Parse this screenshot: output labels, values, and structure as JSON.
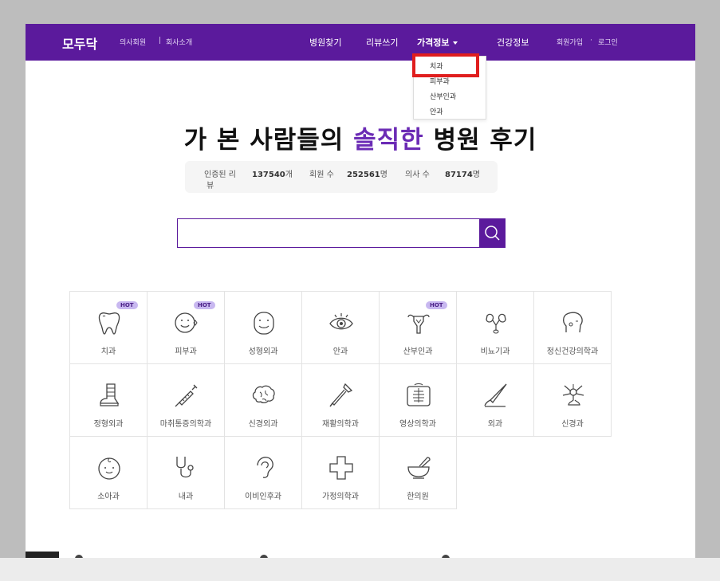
{
  "nav": {
    "logo": "모두닥",
    "doctor_member": "의사회원",
    "separator": "|",
    "company_intro": "회사소개",
    "find_hospital": "병원찾기",
    "write_review": "리뷰쓰기",
    "price_info": "가격정보",
    "health_info": "건강정보",
    "signup": "회원가입",
    "dot": "·",
    "login": "로그인"
  },
  "dropdown": {
    "items": [
      "치과",
      "피부과",
      "산부인과",
      "안과"
    ]
  },
  "hero": {
    "headline_part1": "가 본 사람들의 ",
    "headline_highlight": "솔직한",
    "headline_part2": " 병원 후기"
  },
  "stats": {
    "verified_label": "인증된 리",
    "verified_label_wrap": "뷰",
    "verified_value": "137540",
    "verified_unit": "개",
    "members_label": "회원 수",
    "members_value": "252561",
    "members_unit": "명",
    "doctors_label": "의사 수",
    "doctors_value": "87174",
    "doctors_unit": "명"
  },
  "search": {
    "placeholder": ""
  },
  "departments": [
    {
      "label": "치과",
      "icon": "tooth-icon",
      "hot": "HOT"
    },
    {
      "label": "피부과",
      "icon": "face-sparkle-icon",
      "hot": "HOT"
    },
    {
      "label": "성형외과",
      "icon": "face-icon",
      "hot": ""
    },
    {
      "label": "안과",
      "icon": "eye-icon",
      "hot": ""
    },
    {
      "label": "산부인과",
      "icon": "uterus-icon",
      "hot": "HOT"
    },
    {
      "label": "비뇨기과",
      "icon": "kidney-icon",
      "hot": ""
    },
    {
      "label": "정신건강의학과",
      "icon": "mind-face-icon",
      "hot": ""
    },
    {
      "label": "정형외과",
      "icon": "cast-icon",
      "hot": ""
    },
    {
      "label": "마취통증의학과",
      "icon": "syringe-icon",
      "hot": ""
    },
    {
      "label": "신경외과",
      "icon": "brain-icon",
      "hot": ""
    },
    {
      "label": "재활의학과",
      "icon": "crutch-icon",
      "hot": ""
    },
    {
      "label": "영상의학과",
      "icon": "xray-icon",
      "hot": ""
    },
    {
      "label": "외과",
      "icon": "scalpel-icon",
      "hot": ""
    },
    {
      "label": "신경과",
      "icon": "neuron-icon",
      "hot": ""
    },
    {
      "label": "소아과",
      "icon": "baby-icon",
      "hot": ""
    },
    {
      "label": "내과",
      "icon": "stethoscope-icon",
      "hot": ""
    },
    {
      "label": "이비인후과",
      "icon": "ear-icon",
      "hot": ""
    },
    {
      "label": "가정의학과",
      "icon": "medical-cross-icon",
      "hot": ""
    },
    {
      "label": "한의원",
      "icon": "mortar-pestle-icon",
      "hot": ""
    }
  ],
  "colors": {
    "brand": "#5b1a9c",
    "highlight": "#6b2bb5",
    "annotation": "#e01e1e",
    "hot_badge": "#c8b8f0"
  }
}
